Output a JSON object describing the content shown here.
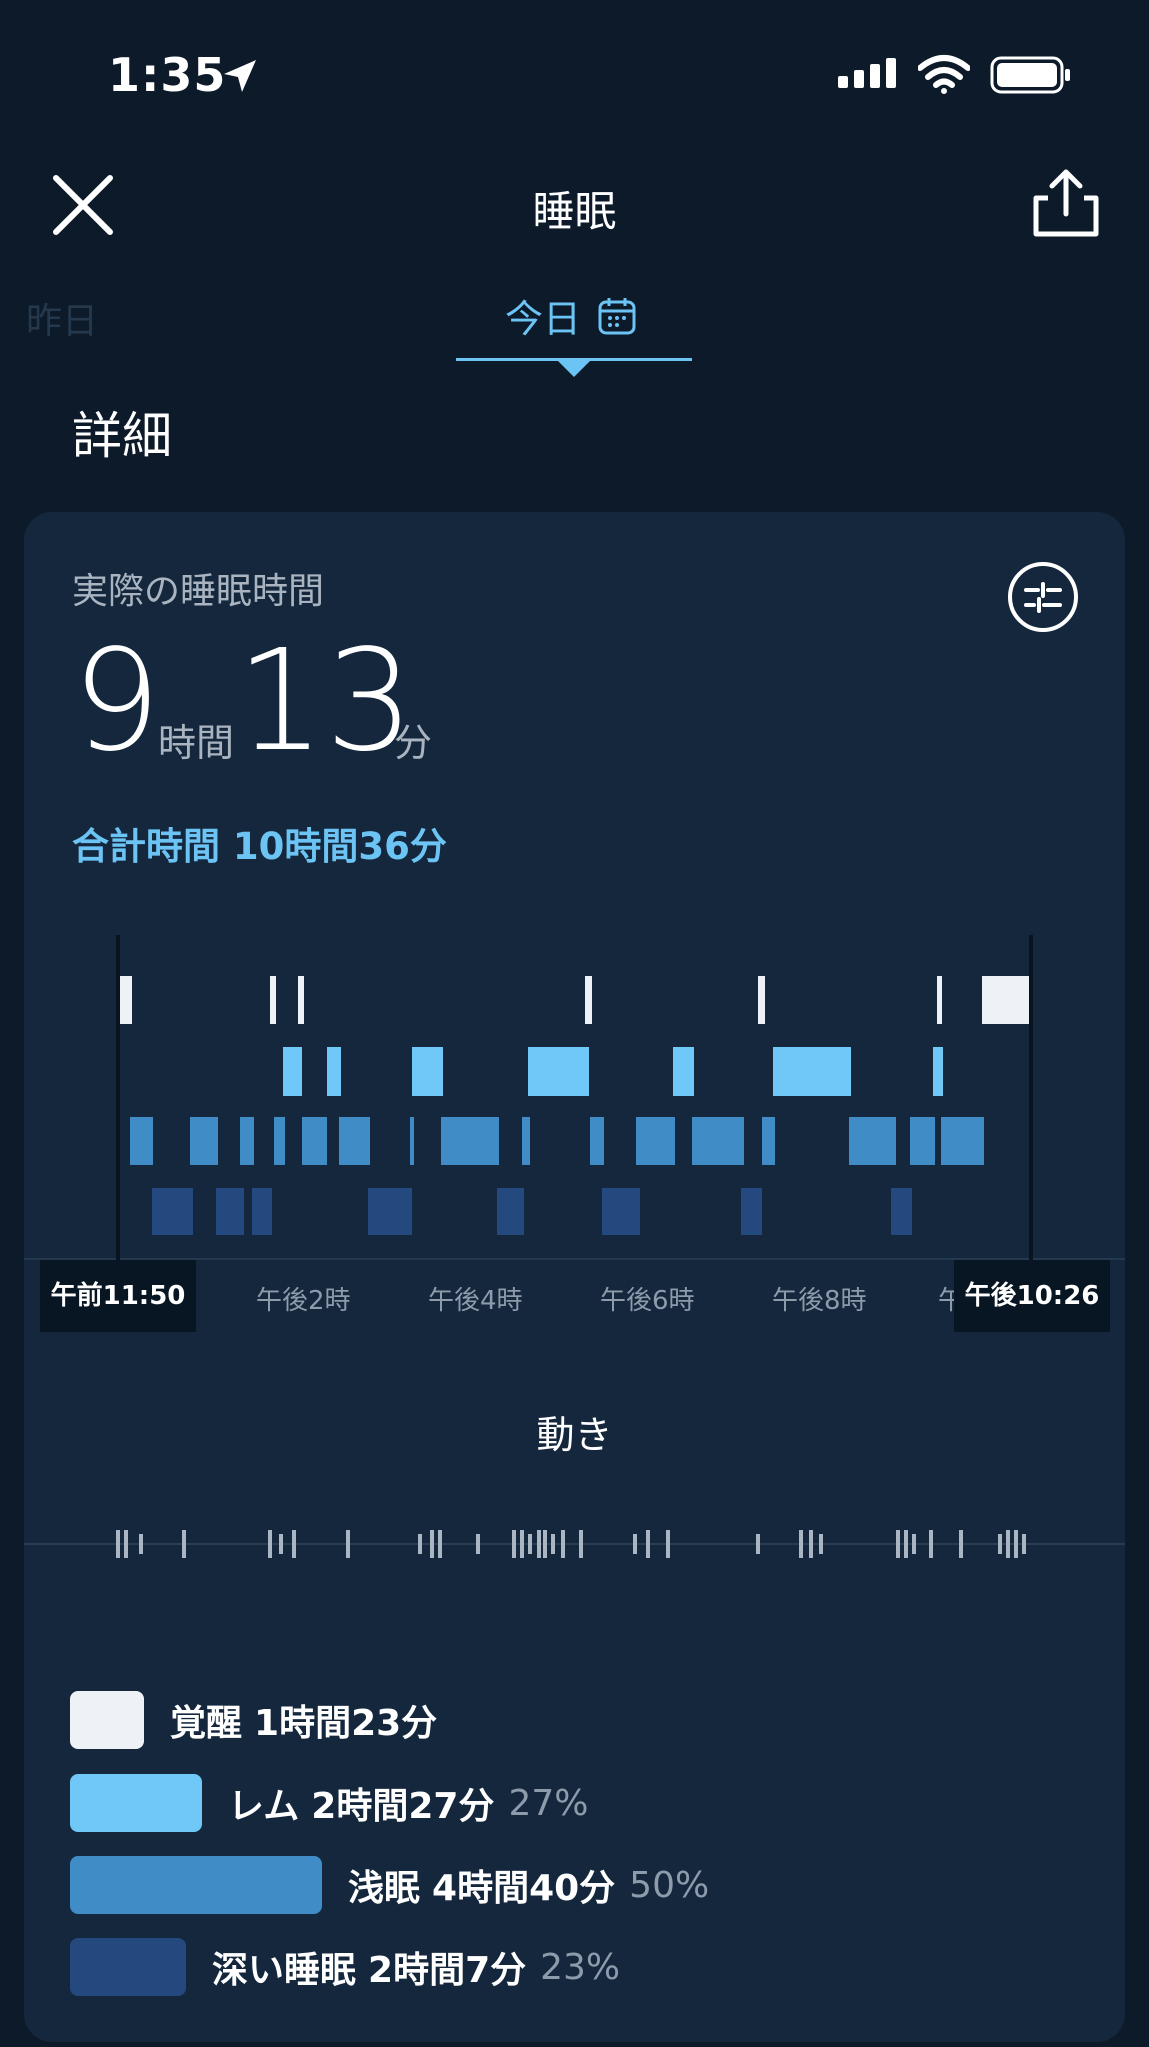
{
  "status": {
    "time": "1:35"
  },
  "header": {
    "title": "睡眠"
  },
  "tabs": {
    "prev": "昨日",
    "current": "今日"
  },
  "section_title": "詳細",
  "summary": {
    "label": "実際の睡眠時間",
    "hours": "9",
    "hours_unit": "時間",
    "minutes": "13",
    "minutes_unit": "分",
    "total": "合計時間 10時間36分"
  },
  "chart_data": {
    "type": "step",
    "start_label": "午前11:50",
    "end_label": "午後10:26",
    "x_tick_labels": [
      "午後2時",
      "午後4時",
      "午後6時",
      "午後8時",
      "午"
    ],
    "levels": [
      "覚醒",
      "レム",
      "浅眠",
      "深い睡眠"
    ],
    "colors": {
      "awake": "#eef2f6",
      "rem": "#6fc8f8",
      "light": "#3f8cc7",
      "deep": "#24497f"
    }
  },
  "movement_title": "動き",
  "legend": [
    {
      "label": "覚醒",
      "duration": "1時間23分",
      "pct": "",
      "color": "#eef2f6"
    },
    {
      "label": "レム",
      "duration": "2時間27分",
      "pct": "27%",
      "color": "#6fc8f8"
    },
    {
      "label": "浅眠",
      "duration": "4時間40分",
      "pct": "50%",
      "color": "#3f8cc7"
    },
    {
      "label": "深い睡眠",
      "duration": "2時間7分",
      "pct": "23%",
      "color": "#24497f"
    }
  ]
}
